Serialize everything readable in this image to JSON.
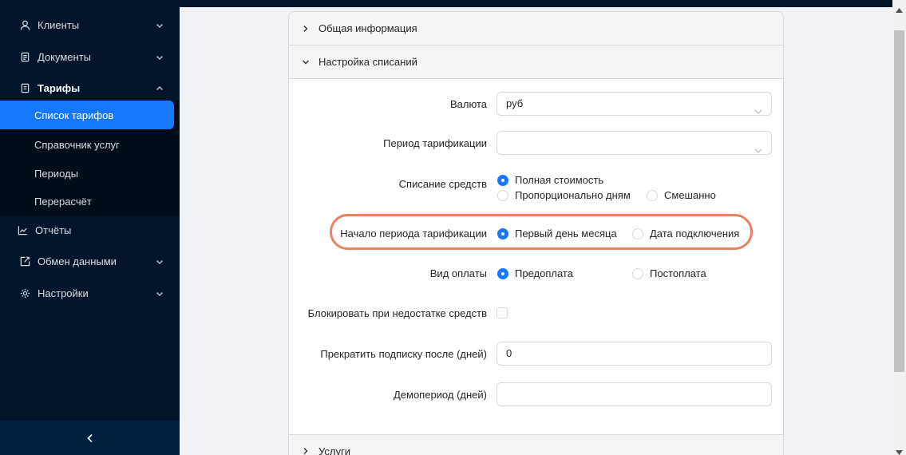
{
  "sidebar": {
    "items": [
      {
        "label": "Клиенты",
        "icon": "user-icon"
      },
      {
        "label": "Документы",
        "icon": "document-icon"
      },
      {
        "label": "Тарифы",
        "icon": "tariff-icon"
      },
      {
        "label": "Отчёты",
        "icon": "chart-icon"
      },
      {
        "label": "Обмен данными",
        "icon": "exchange-icon"
      },
      {
        "label": "Настройки",
        "icon": "gear-icon"
      }
    ],
    "submenu": [
      {
        "label": "Список тарифов",
        "active": true
      },
      {
        "label": "Справочник услуг"
      },
      {
        "label": "Периоды"
      },
      {
        "label": "Перерасчёт"
      }
    ]
  },
  "panels": {
    "general": "Общая информация",
    "charges": "Настройка списаний",
    "services": "Услуги"
  },
  "form": {
    "currency": {
      "label": "Валюта",
      "value": "руб"
    },
    "period": {
      "label": "Период тарификации",
      "value": ""
    },
    "charging": {
      "label": "Списание средств",
      "options": [
        "Полная стоимость",
        "Пропорционально дням",
        "Смешанно"
      ],
      "selected": "Полная стоимость"
    },
    "period_start": {
      "label": "Начало периода тарификации",
      "options": [
        "Первый день месяца",
        "Дата подключения"
      ],
      "selected": "Первый день месяца"
    },
    "payment": {
      "label": "Вид оплаты",
      "options": [
        "Предоплата",
        "Постоплата"
      ],
      "selected": "Предоплата"
    },
    "block": {
      "label": "Блокировать при недостатке средств",
      "checked": false
    },
    "stop_after": {
      "label": "Прекратить подписку после (дней)",
      "value": "0"
    },
    "demo": {
      "label": "Демопериод (дней)",
      "value": ""
    }
  },
  "colors": {
    "accent": "#1677ff",
    "sidebar": "#001529",
    "highlight": "#ea8364"
  }
}
